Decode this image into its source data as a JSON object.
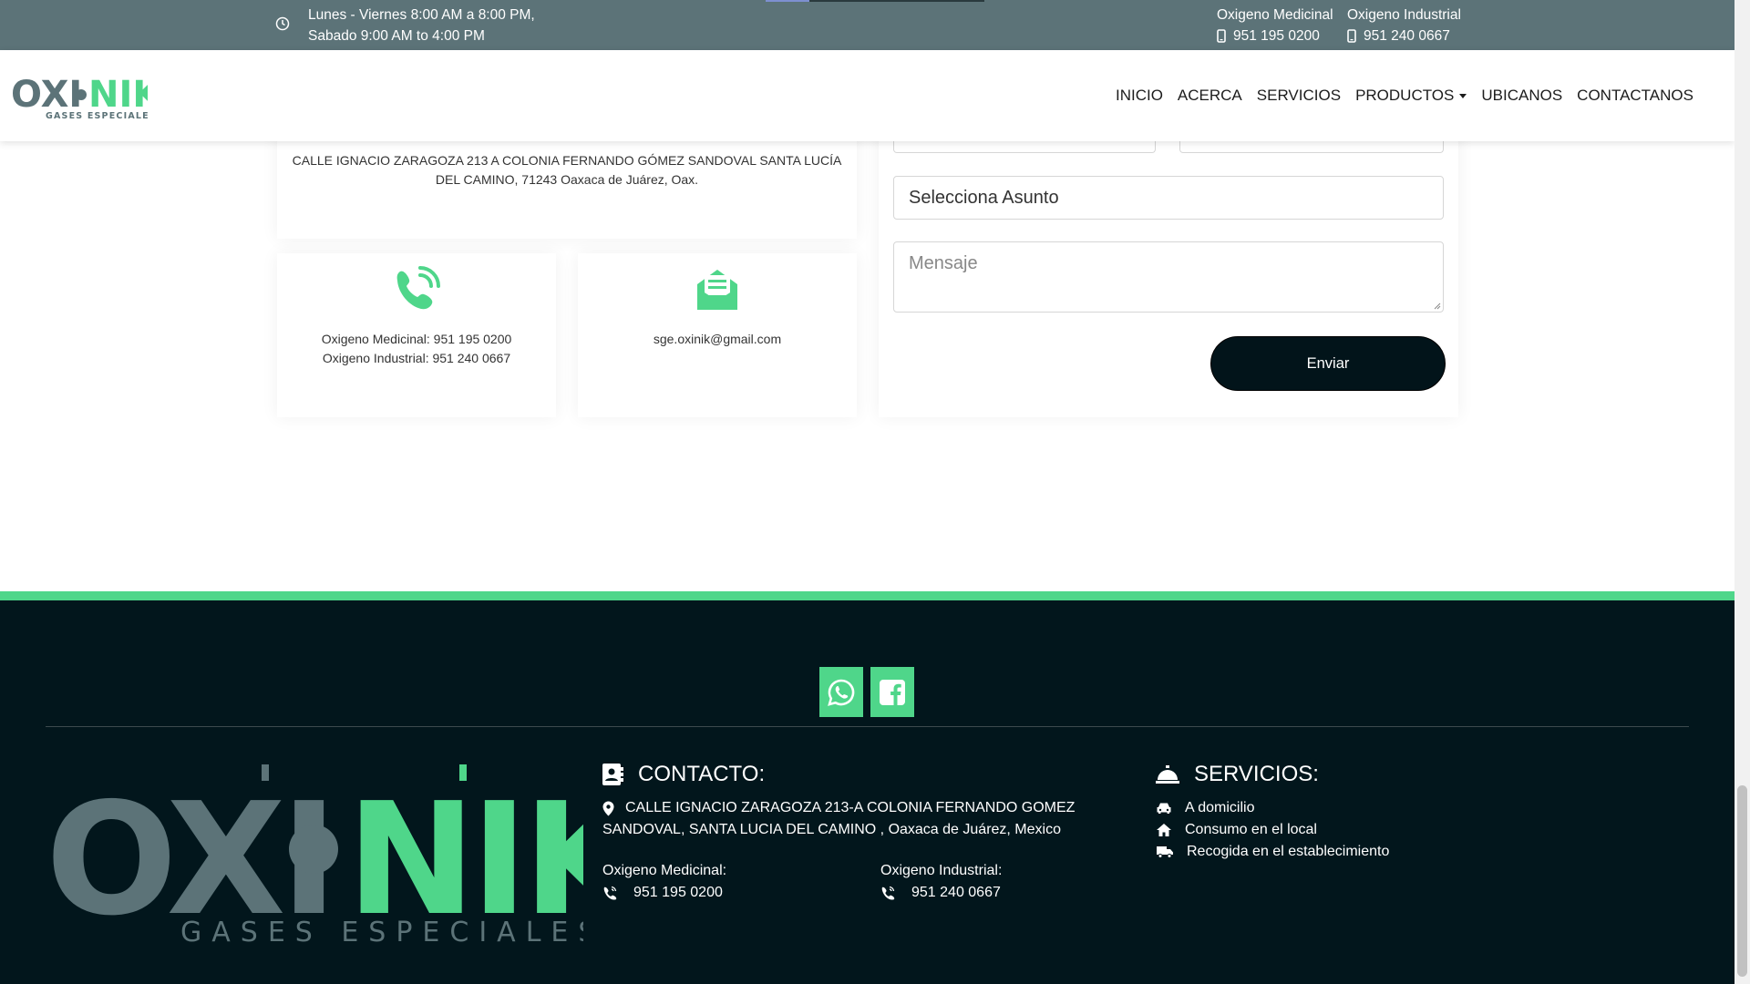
{
  "topbar": {
    "hours_line1": "Lunes - Viernes 8:00 AM a 8:00 PM,",
    "hours_line2": "Sabado 9:00 AM to 4:00 PM",
    "medicinal_label": "Oxigeno Medicinal",
    "medicinal_phone": "951 195 0200",
    "industrial_label": "Oxigeno Industrial",
    "industrial_phone": "951 240 0667"
  },
  "nav": {
    "logo_left": "OXI",
    "logo_right": "NIK",
    "logo_sub": "GASES ESPECIALES",
    "items": [
      "INICIO",
      "ACERCA",
      "SERVICIOS",
      "PRODUCTOS",
      "UBICANOS",
      "CONTACTANOS"
    ]
  },
  "contact_cards": {
    "address": "CALLE IGNACIO ZARAGOZA 213 A COLONIA FERNANDO GÓMEZ SANDOVAL SANTA LUCÍA DEL CAMINO, 71243 Oaxaca de Juárez, Oax.",
    "phone_line1": "Oxigeno Medicinal: 951 195 0200",
    "phone_line2": "Oxigeno Industrial: 951 240 0667",
    "email": "sge.oxinik@gmail.com"
  },
  "form": {
    "subject_select": "Selecciona Asunto",
    "message_placeholder": "Mensaje",
    "send_label": "Enviar"
  },
  "footer": {
    "logo_left": "OXI",
    "logo_right": "NIK",
    "logo_sub": "GASES ESPECIALES",
    "contact_title": "CONTACTO:",
    "address_line1": "CALLE IGNACIO ZARAGOZA 213-A COLONIA FERNANDO GOMEZ",
    "address_line2": "SANDOVAL, SANTA LUCIA DEL CAMINO , Oaxaca de Juárez, Mexico",
    "medicinal_label": "Oxigeno Medicinal:",
    "medicinal_phone": "951 195 0200",
    "industrial_label": "Oxigeno Industrial:",
    "industrial_phone": "951 240 0667",
    "services_title": "SERVICIOS:",
    "services": [
      "A domicilio",
      "Consumo en el local",
      "Recogida en el establecimiento"
    ]
  },
  "colors": {
    "accent_green": "#4fd68a",
    "topbar_bg": "#5c7378",
    "footer_bg": "#02161c"
  }
}
